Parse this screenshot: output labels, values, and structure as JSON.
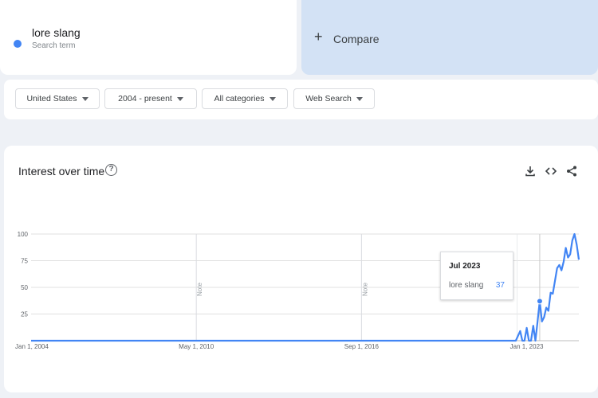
{
  "search_term": {
    "name": "lore slang",
    "subtitle": "Search term",
    "color": "#4285f4"
  },
  "compare": {
    "icon": "plus-icon",
    "label": "Compare"
  },
  "filters": [
    {
      "label": "United States"
    },
    {
      "label": "2004 - present"
    },
    {
      "label": "All categories"
    },
    {
      "label": "Web Search"
    }
  ],
  "chart": {
    "title": "Interest over time",
    "help_icon": "help-circle-icon",
    "actions": [
      "download-icon",
      "embed-code-icon",
      "share-icon"
    ],
    "note_label": "Note",
    "tooltip": {
      "date": "Jul 2023",
      "term": "lore slang",
      "value": "37"
    }
  },
  "chart_data": {
    "type": "line",
    "series": [
      {
        "name": "lore slang",
        "color": "#4285f4",
        "points": [
          [
            "2004-01",
            0
          ],
          [
            "2022-08",
            0
          ],
          [
            "2022-10",
            9
          ],
          [
            "2022-11",
            0
          ],
          [
            "2022-12",
            0
          ],
          [
            "2023-01",
            12
          ],
          [
            "2023-02",
            0
          ],
          [
            "2023-03",
            0
          ],
          [
            "2023-04",
            14
          ],
          [
            "2023-05",
            0
          ],
          [
            "2023-06",
            18
          ],
          [
            "2023-07",
            37
          ],
          [
            "2023-08",
            18
          ],
          [
            "2023-09",
            22
          ],
          [
            "2023-10",
            31
          ],
          [
            "2023-11",
            28
          ],
          [
            "2023-12",
            45
          ],
          [
            "2024-01",
            44
          ],
          [
            "2024-02",
            56
          ],
          [
            "2024-03",
            68
          ],
          [
            "2024-04",
            71
          ],
          [
            "2024-05",
            66
          ],
          [
            "2024-06",
            74
          ],
          [
            "2024-07",
            87
          ],
          [
            "2024-08",
            78
          ],
          [
            "2024-09",
            81
          ],
          [
            "2024-10",
            94
          ],
          [
            "2024-11",
            100
          ],
          [
            "2024-12",
            90
          ],
          [
            "2025-01",
            76
          ]
        ]
      }
    ],
    "x_ticks": [
      {
        "date": "2004-01",
        "label": "Jan 1, 2004"
      },
      {
        "date": "2010-05",
        "label": "May 1, 2010"
      },
      {
        "date": "2016-09",
        "label": "Sep 1, 2016"
      },
      {
        "date": "2023-01",
        "label": "Jan 1, 2023"
      }
    ],
    "y_ticks": [
      "25",
      "50",
      "75",
      "100"
    ],
    "ylim": [
      0,
      100
    ],
    "xlim": [
      "2004-01",
      "2025-01"
    ],
    "notes": [
      "2010-05",
      "2016-09"
    ],
    "highlight": "2023-07",
    "grid": true
  }
}
